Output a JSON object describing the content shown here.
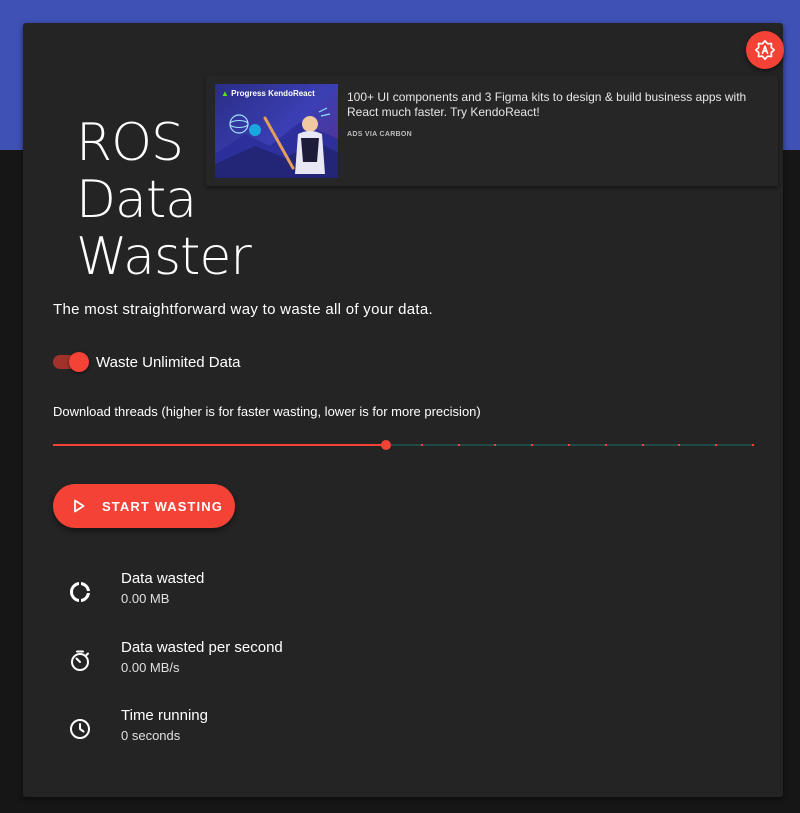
{
  "app": {
    "title": "ROS\nData\nWaster",
    "subtitle": "The most straightforward way to waste all of your data."
  },
  "colors": {
    "accent": "#f44336",
    "header_band": "#3f51b5",
    "card_background": "#242424",
    "page_background": "#161616",
    "slider_rail": "#1d4a46"
  },
  "settings_button": {
    "icon": "brightness-auto-icon"
  },
  "ad": {
    "brand": "Progress KendoReact",
    "text": "100+ UI components and 3 Figma kits to design & build business apps with React much faster. Try KendoReact!",
    "via": "ADS VIA CARBON"
  },
  "unlimited_toggle": {
    "label": "Waste Unlimited Data",
    "checked": true
  },
  "threads_slider": {
    "label": "Download threads (higher is for faster wasting, lower is for more precision)",
    "fill_fraction": 0.475,
    "mark_count": 10
  },
  "start_button": {
    "label": "START WASTING",
    "icon": "play-outline-icon"
  },
  "stats": [
    {
      "title": "Data wasted",
      "value": "0.00 MB",
      "icon": "donut-progress-icon"
    },
    {
      "title": "Data wasted per second",
      "value": "0.00 MB/s",
      "icon": "timer-icon"
    },
    {
      "title": "Time running",
      "value": "0 seconds",
      "icon": "clock-icon"
    }
  ]
}
